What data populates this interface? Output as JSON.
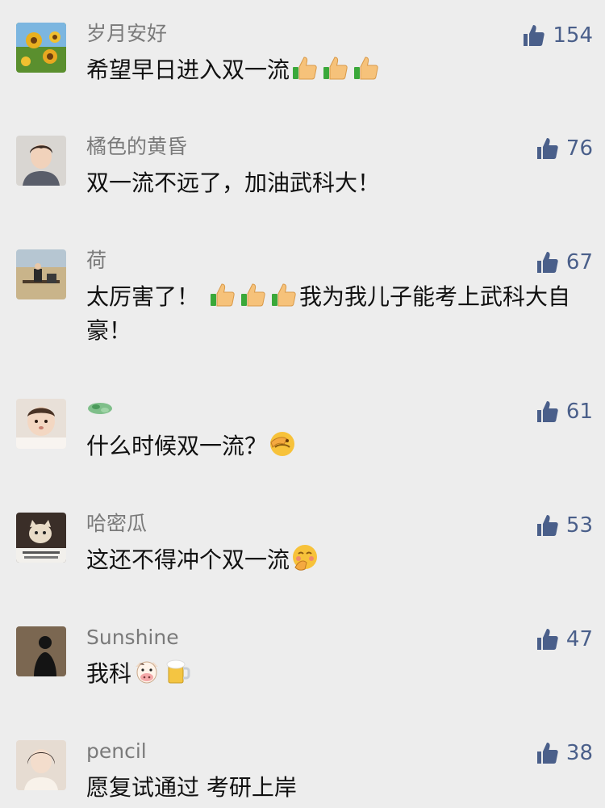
{
  "comments": [
    {
      "name": "岁月安好",
      "text_before": "希望早日进入双一流",
      "text_after": "",
      "likes": "154"
    },
    {
      "name": "橘色的黄昏",
      "text_before": "双一流不远了，加油武科大！",
      "text_after": "",
      "likes": "76"
    },
    {
      "name": "荷",
      "text_before": "太厉害了！",
      "text_after": "我为我儿子能考上武科大自豪！",
      "likes": "67"
    },
    {
      "name": "",
      "text_before": "什么时候双一流？",
      "text_after": "",
      "likes": "61"
    },
    {
      "name": "哈密瓜",
      "text_before": "这还不得冲个双一流",
      "text_after": "",
      "likes": "53"
    },
    {
      "name": "Sunshine",
      "text_before": "我科",
      "text_after": "",
      "likes": "47"
    },
    {
      "name": "pencil",
      "text_before": "愿复试通过 考研上岸",
      "text_after": "",
      "likes": "38"
    }
  ],
  "colors": {
    "background": "#ededed",
    "like_blue": "#4a5f8a",
    "username_gray": "#7a7a7a"
  }
}
